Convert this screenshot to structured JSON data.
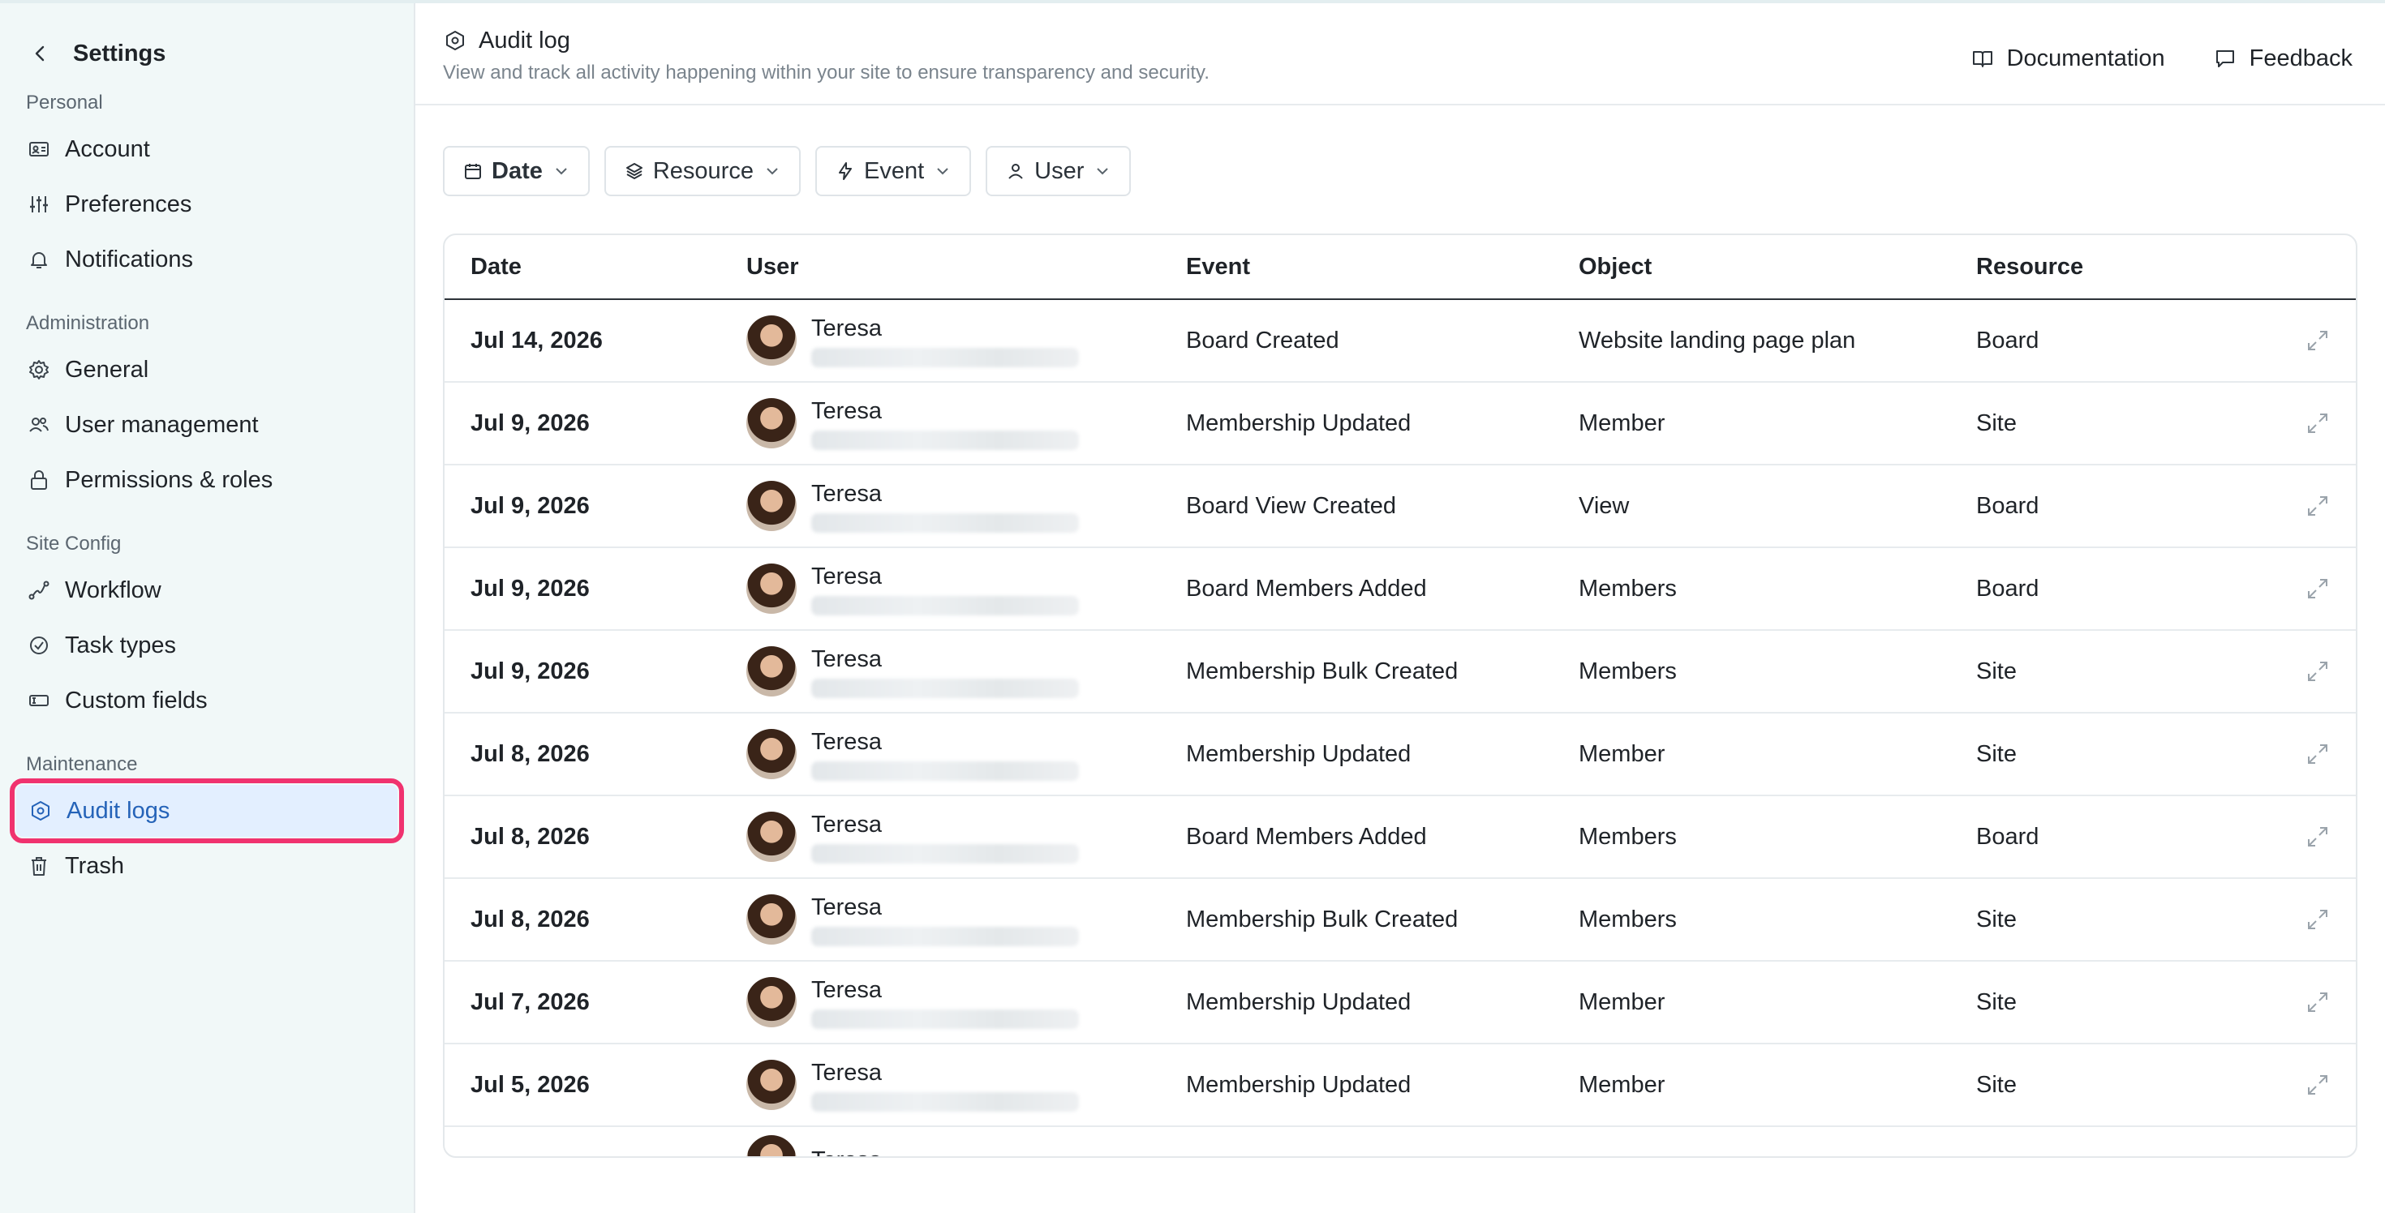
{
  "sidebar": {
    "title": "Settings",
    "sections": [
      {
        "label": "Personal",
        "items": [
          {
            "label": "Account",
            "icon": "id-card-icon"
          },
          {
            "label": "Preferences",
            "icon": "sliders-icon"
          },
          {
            "label": "Notifications",
            "icon": "bell-icon"
          }
        ]
      },
      {
        "label": "Administration",
        "items": [
          {
            "label": "General",
            "icon": "gear-icon"
          },
          {
            "label": "User management",
            "icon": "users-icon"
          },
          {
            "label": "Permissions & roles",
            "icon": "lock-icon"
          }
        ]
      },
      {
        "label": "Site Config",
        "items": [
          {
            "label": "Workflow",
            "icon": "workflow-icon"
          },
          {
            "label": "Task types",
            "icon": "check-circle-icon"
          },
          {
            "label": "Custom fields",
            "icon": "custom-field-icon"
          }
        ]
      },
      {
        "label": "Maintenance",
        "items": [
          {
            "label": "Audit logs",
            "icon": "hexagon-icon",
            "active": true
          },
          {
            "label": "Trash",
            "icon": "trash-icon"
          }
        ]
      }
    ]
  },
  "header": {
    "title": "Audit log",
    "subtitle": "View and track all activity happening within your site to ensure transparency and security.",
    "documentation": "Documentation",
    "feedback": "Feedback"
  },
  "filters": [
    "Date",
    "Resource",
    "Event",
    "User"
  ],
  "table": {
    "columns": [
      "Date",
      "User",
      "Event",
      "Object",
      "Resource"
    ],
    "rows": [
      {
        "date": "Jul 14, 2026",
        "user": "Teresa",
        "event": "Board Created",
        "object": "Website landing page plan",
        "resource": "Board"
      },
      {
        "date": "Jul 9, 2026",
        "user": "Teresa",
        "event": "Membership Updated",
        "object": "Member",
        "resource": "Site"
      },
      {
        "date": "Jul 9, 2026",
        "user": "Teresa",
        "event": "Board View Created",
        "object": "View",
        "resource": "Board"
      },
      {
        "date": "Jul 9, 2026",
        "user": "Teresa",
        "event": "Board Members Added",
        "object": "Members",
        "resource": "Board"
      },
      {
        "date": "Jul 9, 2026",
        "user": "Teresa",
        "event": "Membership Bulk Created",
        "object": "Members",
        "resource": "Site"
      },
      {
        "date": "Jul 8, 2026",
        "user": "Teresa",
        "event": "Membership Updated",
        "object": "Member",
        "resource": "Site"
      },
      {
        "date": "Jul 8, 2026",
        "user": "Teresa",
        "event": "Board Members Added",
        "object": "Members",
        "resource": "Board"
      },
      {
        "date": "Jul 8, 2026",
        "user": "Teresa",
        "event": "Membership Bulk Created",
        "object": "Members",
        "resource": "Site"
      },
      {
        "date": "Jul 7, 2026",
        "user": "Teresa",
        "event": "Membership Updated",
        "object": "Member",
        "resource": "Site"
      },
      {
        "date": "Jul 5, 2026",
        "user": "Teresa",
        "event": "Membership Updated",
        "object": "Member",
        "resource": "Site"
      }
    ],
    "partial_row_user": "Teresa"
  },
  "colors": {
    "sidebar_bg": "#f1f8f8",
    "active_bg": "#e3efff",
    "active_text": "#2563b8",
    "highlight_border": "#f0326f"
  }
}
